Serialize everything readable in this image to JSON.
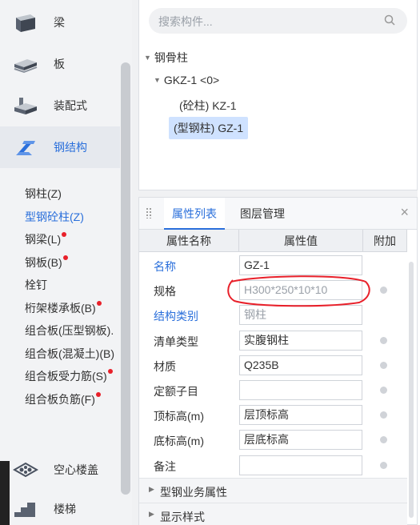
{
  "sidebar": {
    "categories": [
      {
        "label": "梁",
        "icon": "beam-icon"
      },
      {
        "label": "板",
        "icon": "slab-icon"
      },
      {
        "label": "装配式",
        "icon": "prefab-icon"
      },
      {
        "label": "钢结构",
        "icon": "steel-structure-icon"
      },
      {
        "label": "空心楼盖",
        "icon": "hollow-floor-icon"
      },
      {
        "label": "楼梯",
        "icon": "stairs-icon"
      }
    ],
    "steel_items": [
      {
        "label": "钢柱(Z)",
        "badge": false
      },
      {
        "label": "型钢砼柱(Z)",
        "badge": false
      },
      {
        "label": "钢梁(L)",
        "badge": true
      },
      {
        "label": "钢板(B)",
        "badge": true
      },
      {
        "label": "栓钉",
        "badge": false
      },
      {
        "label": "桁架楼承板(B)",
        "badge": true
      },
      {
        "label": "组合板(压型钢板).",
        "badge": false
      },
      {
        "label": "组合板(混凝土)(B)",
        "badge": false
      },
      {
        "label": "组合板受力筋(S)",
        "badge": true
      },
      {
        "label": "组合板负筋(F)",
        "badge": true
      }
    ]
  },
  "search": {
    "placeholder": "搜索构件..."
  },
  "tree": {
    "root": "钢骨柱",
    "child": "GKZ-1 <0>",
    "leaf1": "(砼柱) KZ-1",
    "leaf2": "(型钢柱) GZ-1"
  },
  "tabs": {
    "properties": "属性列表",
    "layers": "图层管理",
    "close": "×"
  },
  "table": {
    "headers": {
      "name": "属性名称",
      "value": "属性值",
      "extra": "附加"
    },
    "rows": [
      {
        "name": "名称",
        "value": "GZ-1",
        "blue": true,
        "addon": false,
        "grey": false
      },
      {
        "name": "规格",
        "value": "H300*250*10*10",
        "blue": false,
        "addon": true,
        "grey": true
      },
      {
        "name": "结构类别",
        "value": "钢柱",
        "blue": true,
        "addon": false,
        "grey": true
      },
      {
        "name": "清单类型",
        "value": "实腹钢柱",
        "blue": false,
        "addon": true,
        "grey": false
      },
      {
        "name": "材质",
        "value": "Q235B",
        "blue": false,
        "addon": true,
        "grey": false
      },
      {
        "name": "定额子目",
        "value": "",
        "blue": false,
        "addon": true,
        "grey": false
      },
      {
        "name": "顶标高(m)",
        "value": "层顶标高",
        "blue": false,
        "addon": true,
        "grey": false
      },
      {
        "name": "底标高(m)",
        "value": "层底标高",
        "blue": false,
        "addon": true,
        "grey": false
      },
      {
        "name": "备注",
        "value": "",
        "blue": false,
        "addon": true,
        "grey": false
      }
    ],
    "sections": [
      "型钢业务属性",
      "显示样式"
    ]
  },
  "colors": {
    "accent": "#2a6fdb",
    "badge": "#e8202a",
    "annotation": "#e8202a"
  }
}
